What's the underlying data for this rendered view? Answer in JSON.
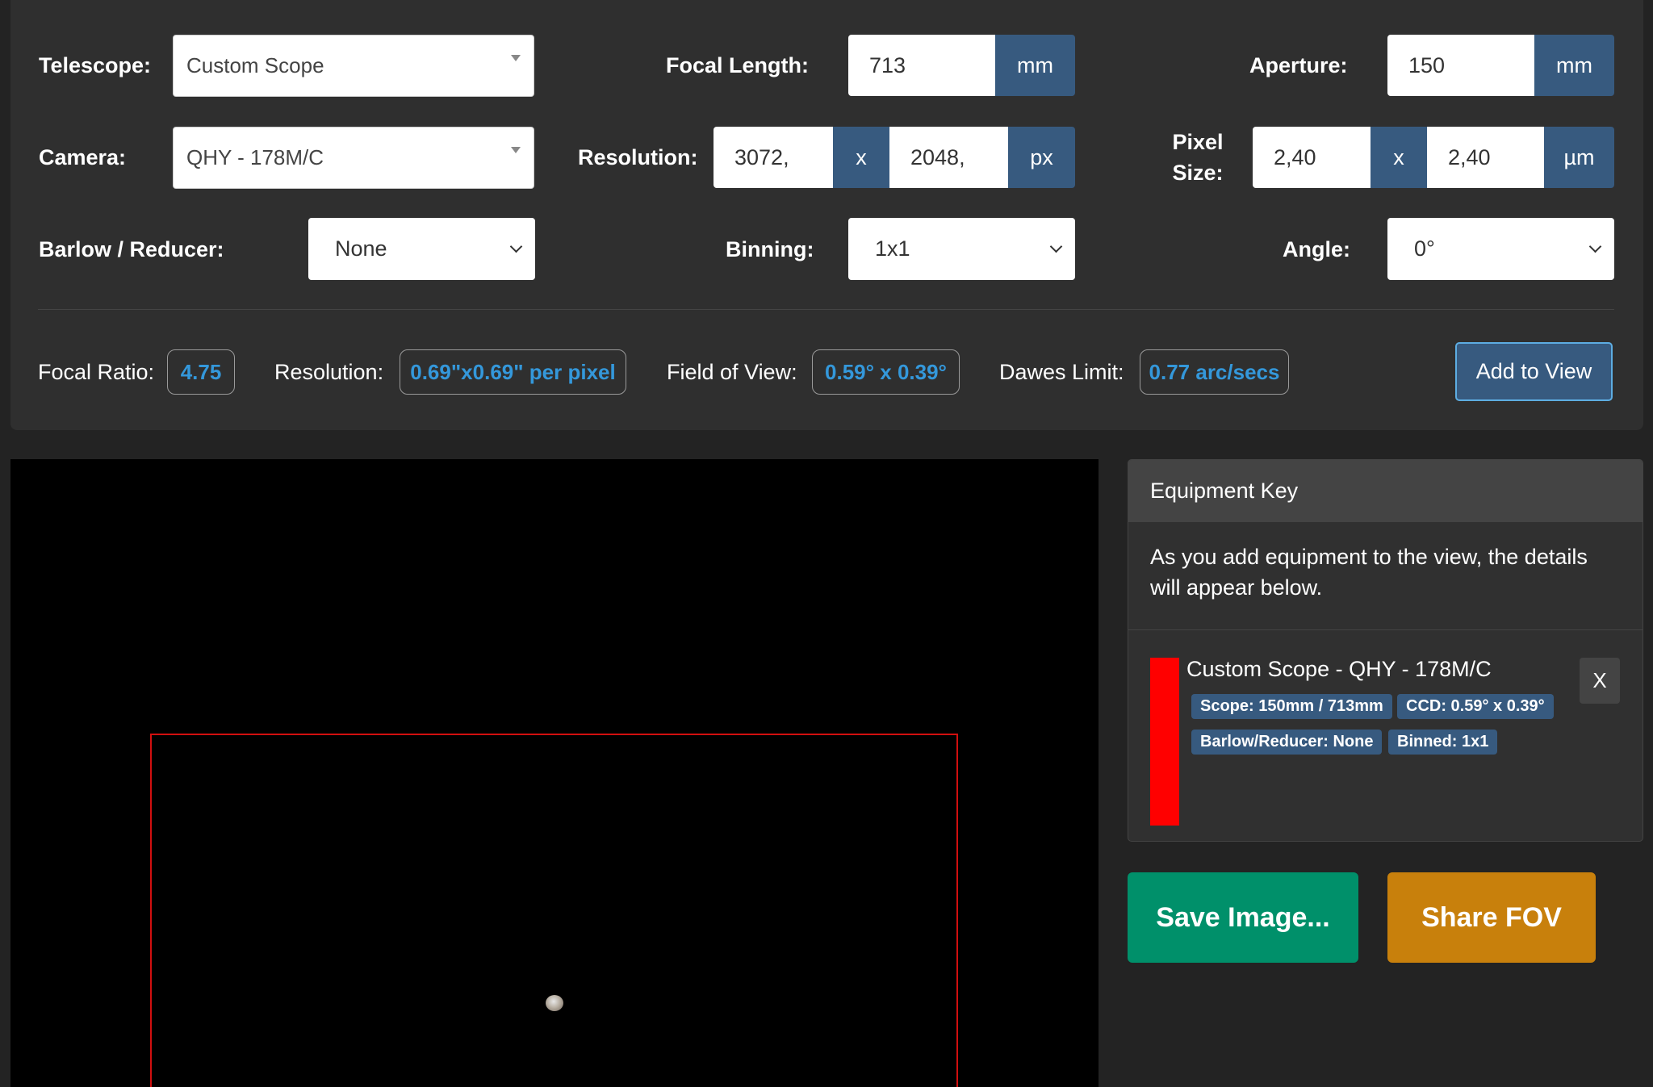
{
  "config": {
    "telescope": {
      "label": "Telescope:",
      "value": "Custom Scope"
    },
    "focal_length": {
      "label": "Focal Length:",
      "value": "713",
      "unit": "mm"
    },
    "aperture": {
      "label": "Aperture:",
      "value": "150",
      "unit": "mm"
    },
    "camera": {
      "label": "Camera:",
      "value": "QHY - 178M/C"
    },
    "resolution": {
      "label": "Resolution:",
      "width": "3072,",
      "sep": "x",
      "height": "2048,",
      "unit": "px"
    },
    "pixel_size": {
      "label_line1": "Pixel",
      "label_line2": "Size:",
      "width": "2,40",
      "sep": "x",
      "height": "2,40",
      "unit": "µm"
    },
    "barlow": {
      "label": "Barlow / Reducer:",
      "value": "None"
    },
    "binning": {
      "label": "Binning:",
      "value": "1x1"
    },
    "angle": {
      "label": "Angle:",
      "value": "0°"
    }
  },
  "results": {
    "focal_ratio": {
      "label": "Focal Ratio:",
      "value": "4.75"
    },
    "resolution": {
      "label": "Resolution:",
      "value": "0.69\"x0.69\" per pixel"
    },
    "field_of_view": {
      "label": "Field of View:",
      "value": "0.59° x 0.39°"
    },
    "dawes_limit": {
      "label": "Dawes Limit:",
      "value": "0.77 arc/secs"
    },
    "add_button": "Add to View"
  },
  "equipment_key": {
    "title": "Equipment Key",
    "description": "As you add equipment to the view, the details will appear below.",
    "item": {
      "title": "Custom Scope - QHY - 178M/C",
      "color": "#ff0000",
      "scope": "Scope: 150mm / 713mm",
      "ccd": "CCD: 0.59° x 0.39°",
      "barlow": "Barlow/Reducer: None",
      "binned": "Binned: 1x1",
      "remove": "X"
    }
  },
  "actions": {
    "save_image": "Save Image...",
    "share_fov": "Share FOV"
  },
  "colors": {
    "background": "#232323",
    "panel": "#2f2f2f",
    "addon": "#375a7f",
    "result_value": "#3498db",
    "fov_outline": "#d10f0f",
    "save_button": "#00906a",
    "share_button": "#c8800c"
  }
}
